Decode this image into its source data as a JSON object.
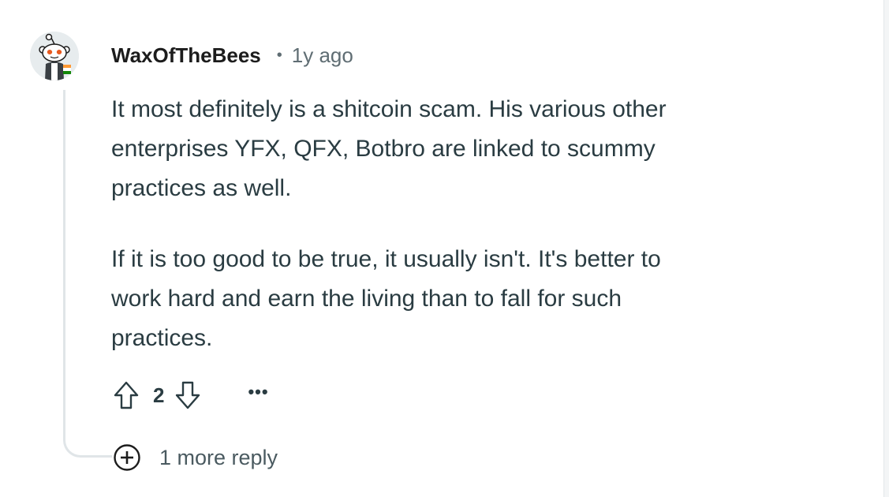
{
  "comment": {
    "username": "WaxOfTheBees",
    "separator": "•",
    "time_ago": "1y ago",
    "paragraphs": [
      "It most definitely is a shitcoin scam. His various other\nenterprises YFX, QFX, Botbro are linked to scummy\npractices as well.",
      "If it is too good to be true, it usually isn't. It's better to\nwork hard and earn the living than to fall for such\npractices."
    ],
    "score": "2",
    "more_options": "•••",
    "more_replies": "1 more reply"
  },
  "icons": {
    "avatar": "snoo-avatar-icon",
    "upvote": "upvote-arrow-icon",
    "downvote": "downvote-arrow-icon",
    "expand": "plus-circle-icon"
  },
  "colors": {
    "text": "#2a3c42",
    "username": "#1c1c1c",
    "meta": "#5f6d73",
    "thread_line": "#e0e5e8"
  }
}
